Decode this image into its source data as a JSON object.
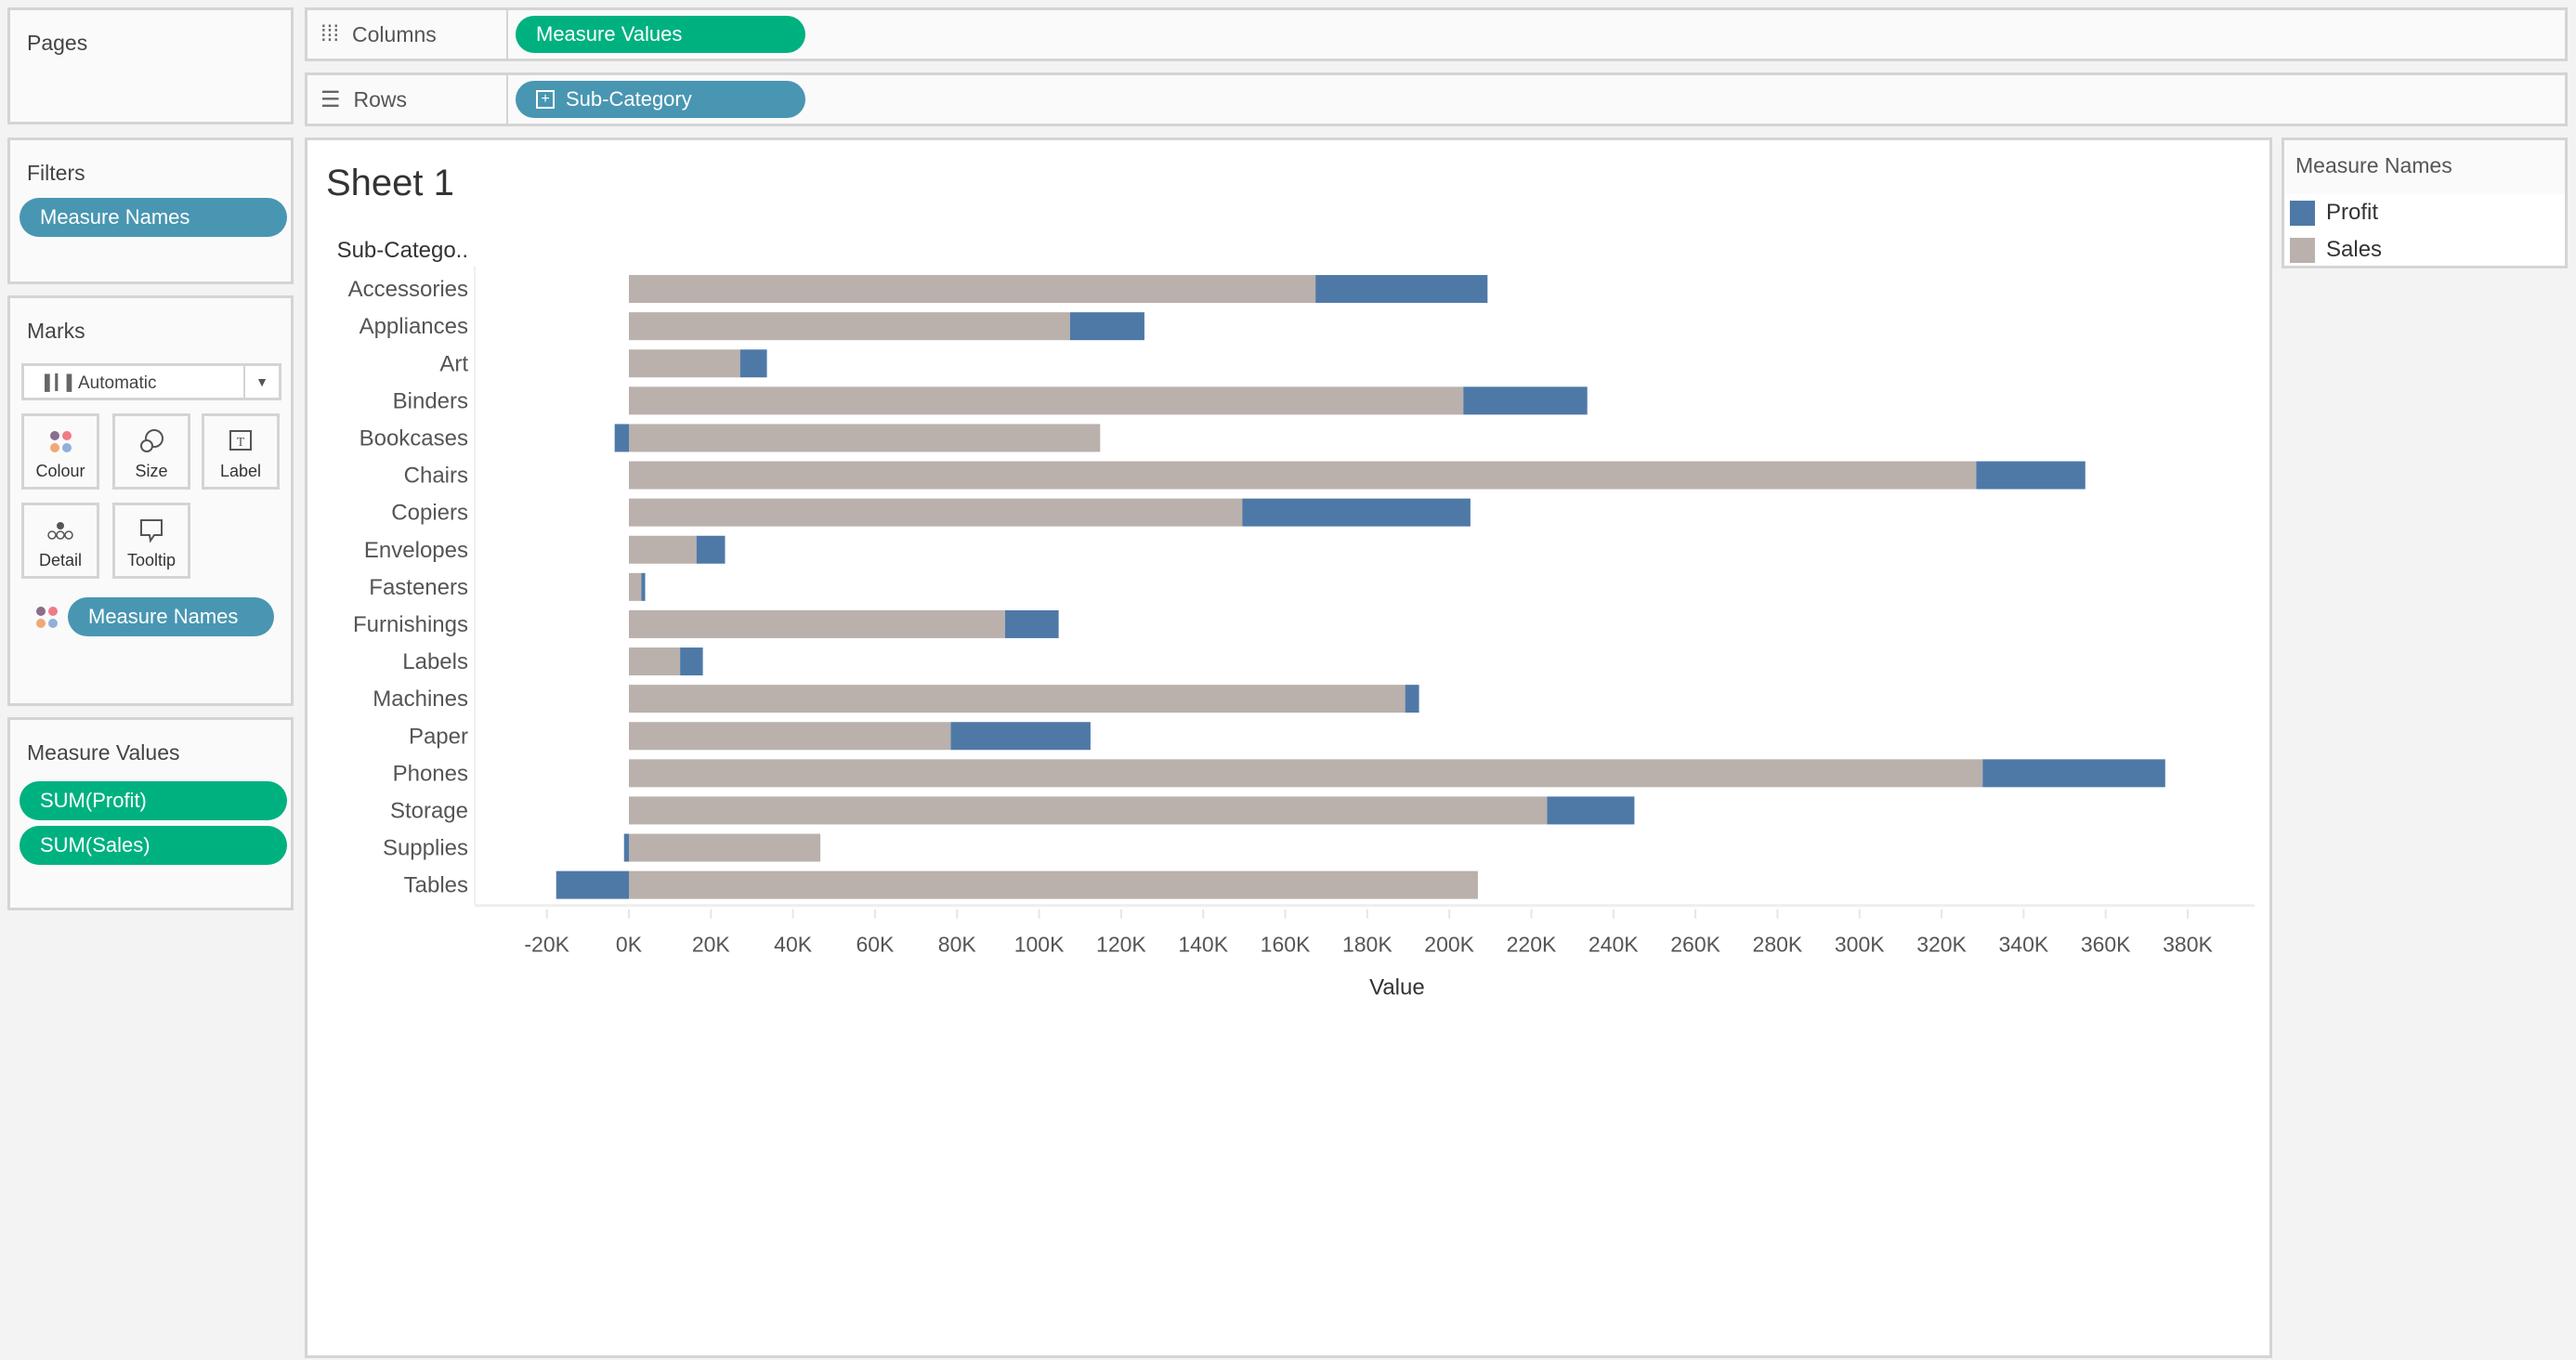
{
  "shelves": {
    "pages_title": "Pages",
    "columns": {
      "label": "Columns",
      "icon": "columns-icon",
      "pill": "Measure Values"
    },
    "rows": {
      "label": "Rows",
      "icon": "rows-icon",
      "pill": "Sub-Category"
    }
  },
  "filters": {
    "title": "Filters",
    "pills": [
      "Measure Names"
    ]
  },
  "marks": {
    "title": "Marks",
    "mark_type": "Automatic",
    "buttons": [
      "Colour",
      "Size",
      "Label",
      "Detail",
      "Tooltip"
    ],
    "colour_pill": "Measure Names"
  },
  "measure_values": {
    "title": "Measure Values",
    "pills": [
      "SUM(Profit)",
      "SUM(Sales)"
    ]
  },
  "legend": {
    "title": "Measure Names",
    "items": [
      {
        "label": "Profit",
        "color": "#4e79a7"
      },
      {
        "label": "Sales",
        "color": "#bab0ac"
      }
    ]
  },
  "sheet": {
    "title": "Sheet 1",
    "row_header": "Sub-Catego.."
  },
  "chart_data": {
    "type": "bar",
    "orientation": "horizontal",
    "stacked": true,
    "title": "Sheet 1",
    "xlabel": "Value",
    "ylabel": "Sub-Category",
    "xlim": [
      -20000,
      390000
    ],
    "xticks": [
      -20000,
      0,
      20000,
      40000,
      60000,
      80000,
      100000,
      120000,
      140000,
      160000,
      180000,
      200000,
      220000,
      240000,
      260000,
      280000,
      300000,
      320000,
      340000,
      360000,
      380000
    ],
    "xtick_labels": [
      "-20K",
      "0K",
      "20K",
      "40K",
      "60K",
      "80K",
      "100K",
      "120K",
      "140K",
      "160K",
      "180K",
      "200K",
      "220K",
      "240K",
      "260K",
      "280K",
      "300K",
      "320K",
      "340K",
      "360K",
      "380K"
    ],
    "categories": [
      "Accessories",
      "Appliances",
      "Art",
      "Binders",
      "Bookcases",
      "Chairs",
      "Copiers",
      "Envelopes",
      "Fasteners",
      "Furnishings",
      "Labels",
      "Machines",
      "Paper",
      "Phones",
      "Storage",
      "Supplies",
      "Tables"
    ],
    "series": [
      {
        "name": "Sales",
        "color": "#bab0ac",
        "values": [
          167380,
          107532,
          27119,
          203413,
          114880,
          328449,
          149528,
          16476,
          3024,
          91705,
          12486,
          189239,
          78479,
          330007,
          223844,
          46674,
          206966
        ]
      },
      {
        "name": "Profit",
        "color": "#4e79a7",
        "values": [
          41937,
          18138,
          6528,
          30222,
          -3473,
          26590,
          55618,
          6964,
          950,
          13059,
          5546,
          3385,
          34054,
          44516,
          21279,
          -1189,
          -17725
        ]
      }
    ],
    "legend": "right",
    "grid": false
  }
}
